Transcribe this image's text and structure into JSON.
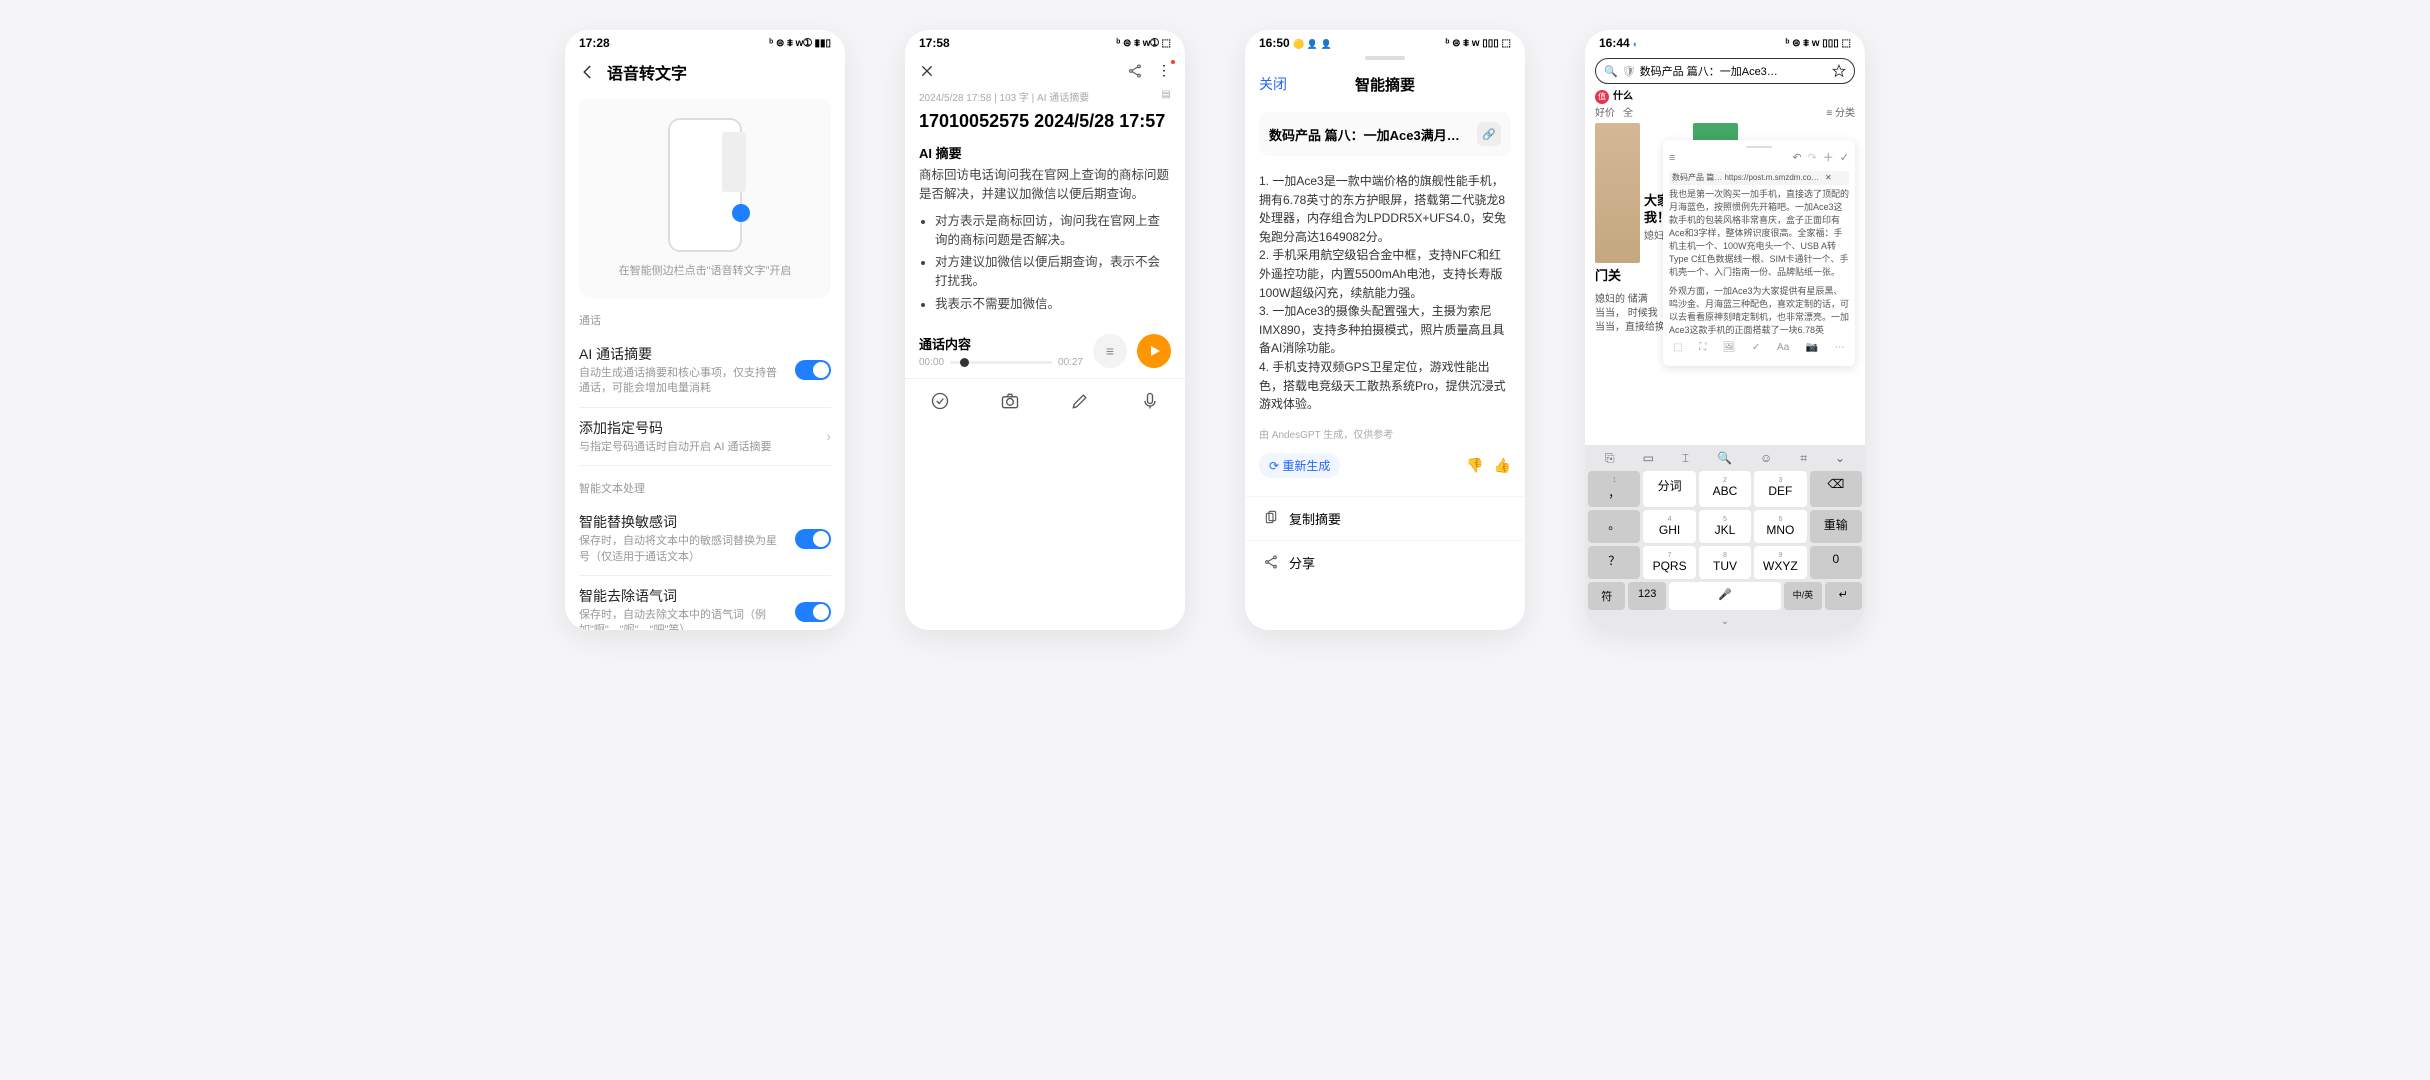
{
  "phoneA": {
    "time": "17:28",
    "statusIcons": "ᵇ ⊜ ⩨ ᴡ➀ ▮▮▯",
    "title": "语音转文字",
    "illusHint": "在智能侧边栏点击\"语音转文字\"开启",
    "section1": "通话",
    "item1_title": "AI 通话摘要",
    "item1_desc": "自动生成通话摘要和核心事项，仅支持普通话，可能会增加电量消耗",
    "item2_title": "添加指定号码",
    "item2_desc": "与指定号码通话时自动开启 AI 通话摘要",
    "section2": "智能文本处理",
    "item3_title": "智能替换敏感词",
    "item3_desc": "保存时，自动将文本中的敏感词替换为星号（仅适用于通话文本）",
    "item4_title": "智能去除语气词",
    "item4_desc": "保存时，自动去除文本中的语气词（例如\"啊\"、\"呢\"、\"吧\"等）"
  },
  "phoneB": {
    "time": "17:58",
    "statusIcons": "ᵇ ⊜ ⩨ ᴡ➀ ⬚",
    "meta": "2024/5/28 17:58 | 103 字 | AI 通话摘要",
    "title": "17010052575 2024/5/28 17:57",
    "sec1": "AI 摘要",
    "body1": "商标回访电话询问我在官网上查询的商标问题是否解决，并建议加微信以便后期查询。",
    "bullet1": "对方表示是商标回访，询问我在官网上查询的商标问题是否解决。",
    "bullet2": "对方建议加微信以便后期查询，表示不会打扰我。",
    "bullet3": "我表示不需要加微信。",
    "sec2": "通话内容",
    "t0": "00:00",
    "t1": "00:27"
  },
  "phoneC": {
    "time": "16:50",
    "statusIcons": "ᵇ ⊜ ⩨ ᴡ ▯▯▯ ⬚",
    "close": "关闭",
    "title": "智能摘要",
    "cardTitle": "数码产品 篇八：一加Ace3满月…",
    "summary": "1. 一加Ace3是一款中端价格的旗舰性能手机，拥有6.78英寸的东方护眼屏，搭载第二代骁龙8处理器，内存组合为LPDDR5X+UFS4.0，安兔兔跑分高达1649082分。\n2. 手机采用航空级铝合金中框，支持NFC和红外遥控功能，内置5500mAh电池，支持长寿版100W超级闪充，续航能力强。\n3. 一加Ace3的摄像头配置强大，主摄为索尼IMX890，支持多种拍摄模式，照片质量高且具备AI消除功能。\n4. 手机支持双频GPS卫星定位，游戏性能出色，搭载电竞级天工散热系统Pro，提供沉浸式游戏体验。",
    "generated": "由 AndesGPT 生成，仅供参考",
    "regen": "⟳ 重新生成",
    "action1": "复制摘要",
    "action2": "分享"
  },
  "phoneD": {
    "time": "16:44",
    "statusIcons": "ᵇ ⊜ ⩨ ᴡ ▯▯▯ ⬚",
    "searchText": "数码产品 篇八：一加Ace3…",
    "logoText": "什么",
    "tabs": [
      "好价",
      "全"
    ],
    "rightTab": "门关",
    "previewTitle": "大家好",
    "previewLine1": "我！",
    "previewLine2": "媳妇的",
    "previewRest": "当当，直接给换了 一加Ace3月海蓝色的顶配版。之所",
    "noteTab": "数码产品 篇…  https://post.m.smzdm.com/p/az…",
    "noteBody1": "我也是第一次购买一加手机，直接选了顶配的月海蓝色，按照惯例先开箱吧。一加Ace3这款手机的包装风格非常喜庆，盒子正面印有Ace和3字样，整体辨识度很高。全家福：手机主机一个、100W充电头一个、USB A转Type C红色数据线一根、SIM卡通针一个、手机壳一个、入门指南一份、品牌贴纸一张。",
    "noteBody2": "外观方面，一加Ace3为大家提供有星辰黑、鸣沙金、月海蓝三种配色，喜欢定制的话，可以去看看原神刻晴定制机，也非常漂亮。一加Ace3这款手机的正面搭载了一块6.78英",
    "tabCat": "分类",
    "kbToolbar": [
      "⎘",
      "▭",
      "⌶",
      "🔍",
      "☺",
      "⌗",
      "⌄"
    ],
    "keys": [
      {
        "sub": "1",
        "main": "，"
      },
      {
        "sub": "",
        "main": "分词"
      },
      {
        "sub": "2",
        "main": "ABC"
      },
      {
        "sub": "3",
        "main": "DEF"
      },
      {
        "sub": "",
        "main": "⌫"
      },
      {
        "sub": "",
        "main": "。"
      },
      {
        "sub": "4",
        "main": "GHI"
      },
      {
        "sub": "5",
        "main": "JKL"
      },
      {
        "sub": "6",
        "main": "MNO"
      },
      {
        "sub": "",
        "main": "重输"
      },
      {
        "sub": "",
        "main": "？"
      },
      {
        "sub": "7",
        "main": "PQRS"
      },
      {
        "sub": "8",
        "main": "TUV"
      },
      {
        "sub": "9",
        "main": "WXYZ"
      },
      {
        "sub": "",
        "main": "0"
      }
    ],
    "spaceKeys": [
      "符",
      "123",
      "🎤",
      "中/英",
      "↵"
    ]
  }
}
